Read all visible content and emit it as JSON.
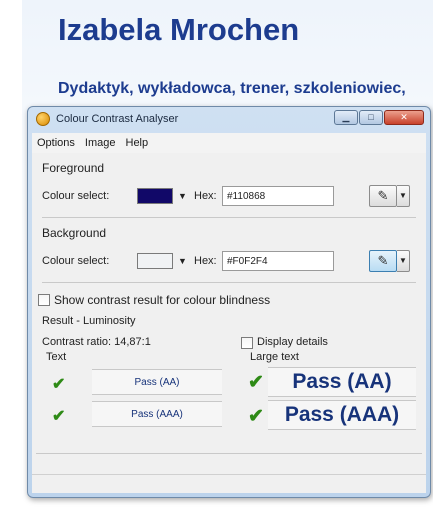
{
  "page": {
    "heading": "Izabela Mrochen",
    "subheading": "Dydaktyk, wykładowca, trener, szkoleniowiec,"
  },
  "window": {
    "title": "Colour Contrast Analyser",
    "icon": "colour-contrast-analyser-icon",
    "controls": [
      "minimize",
      "maximize",
      "close"
    ],
    "menu": [
      "Options",
      "Image",
      "Help"
    ]
  },
  "foreground": {
    "group_label": "Foreground",
    "colour_select_label": "Colour select:",
    "hex_label": "Hex:",
    "hex_value": "#110868",
    "swatch_color": "#110868"
  },
  "background": {
    "group_label": "Background",
    "colour_select_label": "Colour select:",
    "hex_label": "Hex:",
    "hex_value": "#F0F2F4",
    "swatch_color": "#F0F2F4"
  },
  "options": {
    "show_colour_blindness_label": "Show contrast result for colour blindness",
    "show_colour_blindness_checked": false,
    "display_details_label": "Display details",
    "display_details_checked": false
  },
  "result": {
    "section_label": "Result - Luminosity",
    "contrast_ratio_text": "Contrast ratio: 14,87:1",
    "text_header": "Text",
    "large_text_header": "Large text",
    "text_aa": "Pass (AA)",
    "text_aaa": "Pass (AAA)",
    "large_aa": "Pass (AA)",
    "large_aaa": "Pass (AAA)",
    "check_glyph": "✔",
    "pass_color": "#2e8a16"
  }
}
